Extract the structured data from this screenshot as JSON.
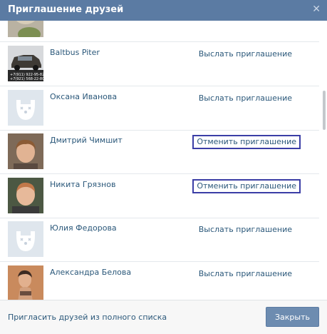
{
  "dialog": {
    "title": "Приглашение друзей",
    "close_icon": "close-icon"
  },
  "friends": [
    {
      "name": "",
      "action": "",
      "avatar": "photo-avatar"
    },
    {
      "name": "Baltbus Piter",
      "action": "Выслать приглашение",
      "avatar_text": "+7(911) 922-95-82\n+7(921) 568-22-80",
      "avatar": "photo-avatar"
    },
    {
      "name": "Оксана Иванова",
      "action": "Выслать приглашение",
      "avatar": "default-dog-avatar"
    },
    {
      "name": "Дмитрий Чимшит",
      "action": "Отменить приглашение",
      "avatar": "photo-avatar"
    },
    {
      "name": "Никита Грязнов",
      "action": "Отменить приглашение",
      "avatar": "photo-avatar"
    },
    {
      "name": "Юлия Федорова",
      "action": "Выслать приглашение",
      "avatar": "default-dog-avatar"
    },
    {
      "name": "Александра Белова",
      "action": "Выслать приглашение",
      "avatar": "photo-avatar"
    }
  ],
  "footer": {
    "invite_all_label": "Пригласить друзей из полного списка",
    "close_button_label": "Закрыть"
  },
  "colors": {
    "title_bar": "#5b7ba3",
    "link": "#2b587a",
    "highlight_box": "#3b3ea6",
    "button": "#6d8cb0"
  }
}
